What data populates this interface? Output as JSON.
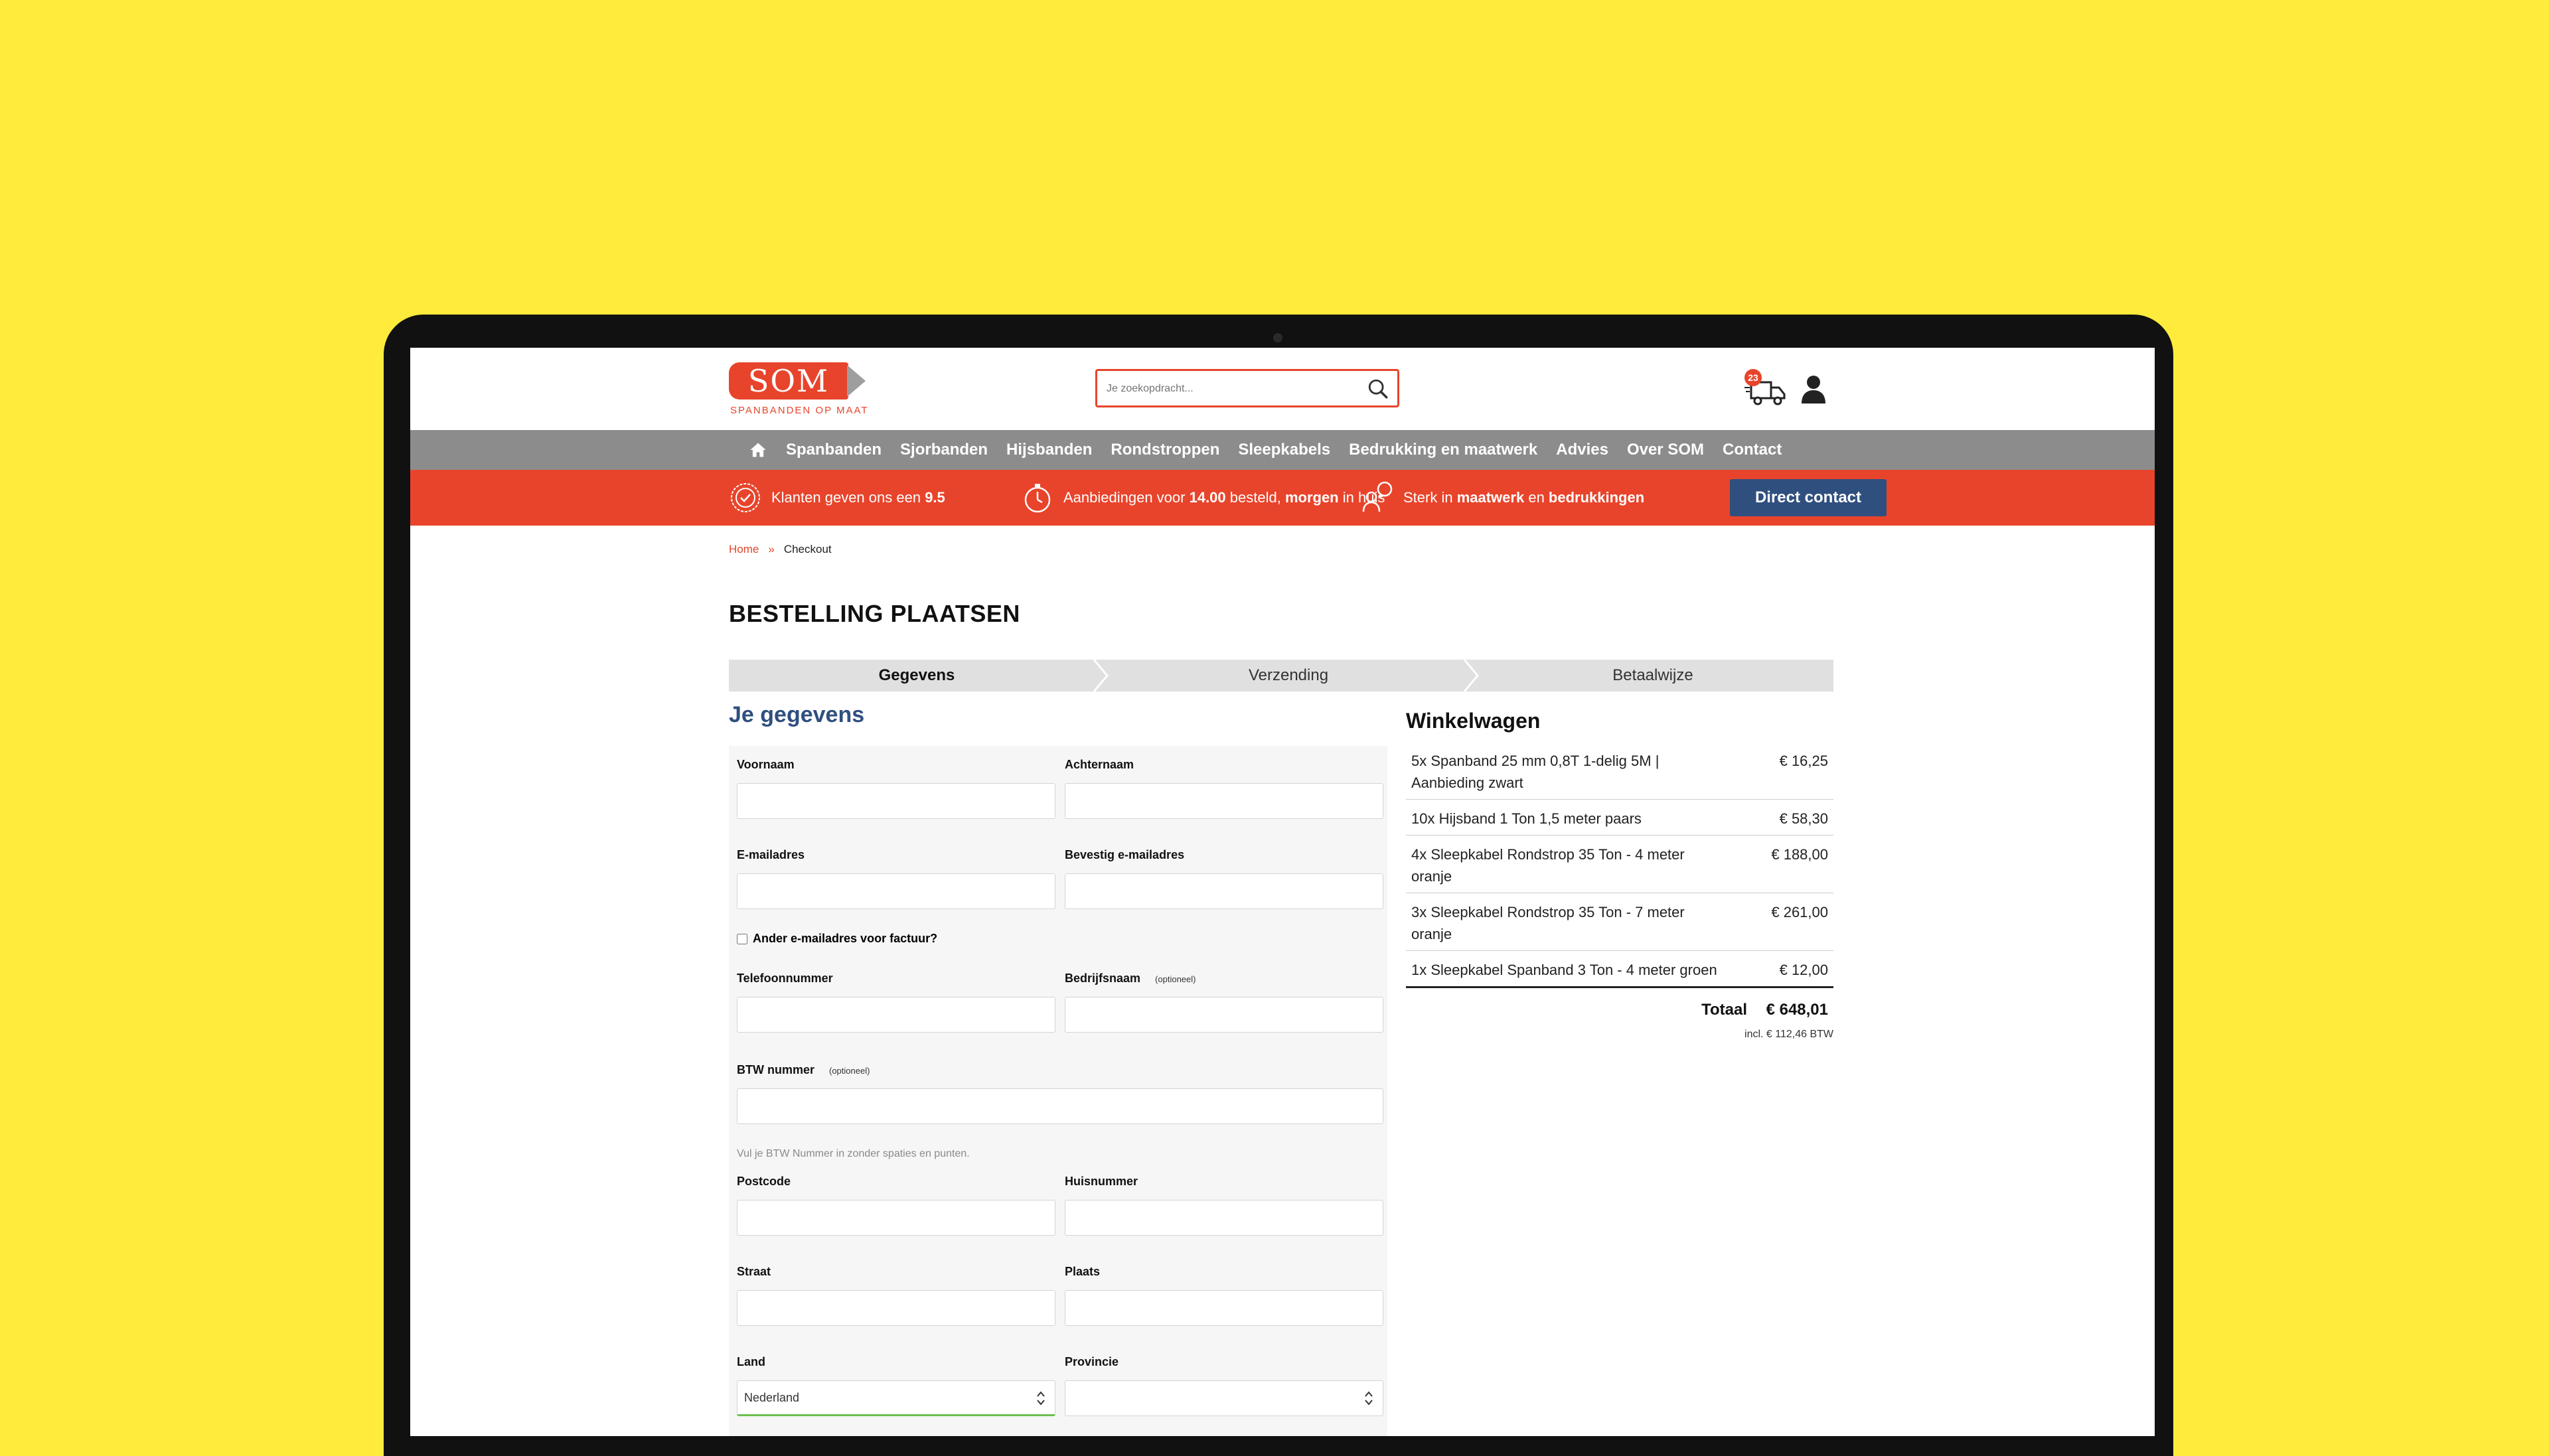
{
  "header": {
    "logo_text": "SOM",
    "logo_sub": "SPANBANDEN OP MAAT",
    "search_placeholder": "Je zoekopdracht...",
    "cart_count": "23"
  },
  "nav": {
    "items": [
      "Spanbanden",
      "Sjorbanden",
      "Hijsbanden",
      "Rondstroppen",
      "Sleepkabels",
      "Bedrukking en maatwerk",
      "Advies",
      "Over SOM",
      "Contact"
    ]
  },
  "promo": {
    "p1_text": "Klanten geven ons een ",
    "p1_bold": "9.5",
    "p2_text": "Aanbiedingen voor ",
    "p2_bold1": "14.00",
    "p2_mid": " besteld, ",
    "p2_bold2": "morgen",
    "p2_end": " in huis",
    "p3_text": "Sterk in ",
    "p3_bold1": "maatwerk",
    "p3_mid": " en ",
    "p3_bold2": "bedrukkingen",
    "button": "Direct contact"
  },
  "breadcrumb": {
    "home": "Home",
    "sep": "»",
    "current": "Checkout"
  },
  "page_title": "BESTELLING PLAATSEN",
  "steps": [
    "Gegevens",
    "Verzending",
    "Betaalwijze"
  ],
  "form": {
    "title": "Je gegevens",
    "voornaam": "Voornaam",
    "achternaam": "Achternaam",
    "email": "E-mailadres",
    "email_confirm": "Bevestig e-mailadres",
    "alt_email": "Ander e-mailadres voor factuur?",
    "telefoon": "Telefoonnummer",
    "bedrijf": "Bedrijfsnaam",
    "optional": "(optioneel)",
    "btw": "BTW nummer",
    "btw_help": "Vul je BTW Nummer in zonder spaties en punten.",
    "postcode": "Postcode",
    "huisnummer": "Huisnummer",
    "straat": "Straat",
    "plaats": "Plaats",
    "land": "Land",
    "land_value": "Nederland",
    "provincie": "Provincie"
  },
  "cart": {
    "title": "Winkelwagen",
    "items": [
      {
        "desc": "5x Spanband 25 mm 0,8T 1-delig 5M | Aanbieding zwart",
        "price": "€ 16,25"
      },
      {
        "desc": "10x Hijsband 1 Ton 1,5 meter paars",
        "price": "€ 58,30"
      },
      {
        "desc": "4x Sleepkabel Rondstrop 35 Ton - 4 meter oranje",
        "price": "€ 188,00"
      },
      {
        "desc": "3x Sleepkabel Rondstrop 35 Ton - 7 meter oranje",
        "price": "€ 261,00"
      },
      {
        "desc": "1x Sleepkabel Spanband 3 Ton - 4 meter groen",
        "price": "€ 12,00"
      }
    ],
    "total_label": "Totaal",
    "total_value": "€ 648,01",
    "btw_note": "incl. € 112,46 BTW"
  }
}
